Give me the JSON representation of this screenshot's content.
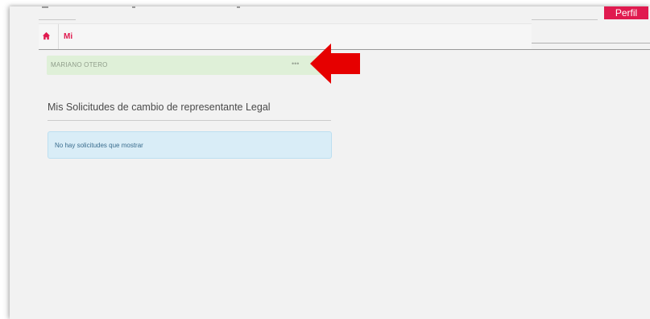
{
  "header": {
    "profile_button": "Perfil"
  },
  "breadcrumb": {
    "label": "Mi"
  },
  "user_bar": {
    "name": "MARIANO OTERO",
    "more": "•••"
  },
  "section": {
    "title": "Mis Solicitudes de cambio de representante Legal",
    "empty_message": "No hay solicitudes que mostrar"
  },
  "colors": {
    "accent": "#e01a4f",
    "arrow": "#e60000",
    "success_bg": "#dff0d8",
    "info_bg": "#d9edf7"
  }
}
